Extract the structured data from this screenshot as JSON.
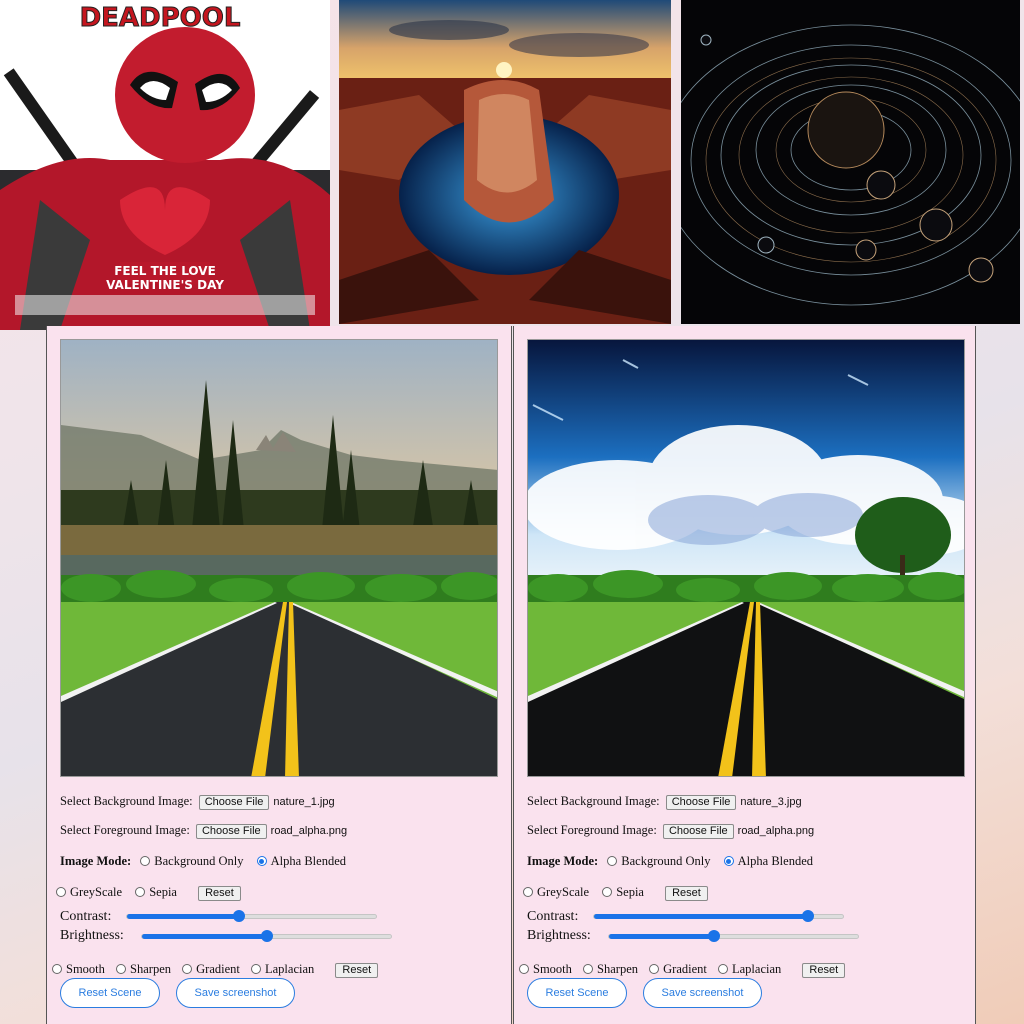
{
  "thumbnails": {
    "poster": {
      "title": "DEADPOOL",
      "tagline_1": "FEEL THE LOVE",
      "tagline_2": "VALENTINE'S DAY"
    }
  },
  "panels": [
    {
      "bg_label": "Select Background Image:",
      "bg_button": "Choose File",
      "bg_file": "nature_1.jpg",
      "fg_label": "Select Foreground Image:",
      "fg_button": "Choose File",
      "fg_file": "road_alpha.png",
      "mode_label": "Image Mode:",
      "mode_options": [
        "Background Only",
        "Alpha Blended"
      ],
      "mode_selected": "Alpha Blended",
      "filter_options": [
        "GreyScale",
        "Sepia"
      ],
      "filter_reset": "Reset",
      "contrast_label": "Contrast:",
      "contrast_value": 0.45,
      "brightness_label": "Brightness:",
      "brightness_value": 0.5,
      "kernel_options": [
        "Smooth",
        "Sharpen",
        "Gradient",
        "Laplacian"
      ],
      "kernel_reset": "Reset",
      "reset_scene": "Reset Scene",
      "save_screenshot": "Save screenshot"
    },
    {
      "bg_label": "Select Background Image:",
      "bg_button": "Choose File",
      "bg_file": "nature_3.jpg",
      "fg_label": "Select Foreground Image:",
      "fg_button": "Choose File",
      "fg_file": "road_alpha.png",
      "mode_label": "Image Mode:",
      "mode_options": [
        "Background Only",
        "Alpha Blended"
      ],
      "mode_selected": "Alpha Blended",
      "filter_options": [
        "GreyScale",
        "Sepia"
      ],
      "filter_reset": "Reset",
      "contrast_label": "Contrast:",
      "contrast_value": 0.86,
      "brightness_label": "Brightness:",
      "brightness_value": 0.42,
      "kernel_options": [
        "Smooth",
        "Sharpen",
        "Gradient",
        "Laplacian"
      ],
      "kernel_reset": "Reset",
      "reset_scene": "Reset Scene",
      "save_screenshot": "Save screenshot"
    }
  ],
  "colors": {
    "accent": "#1a73e8",
    "panel_bg": "#fae2ee"
  }
}
